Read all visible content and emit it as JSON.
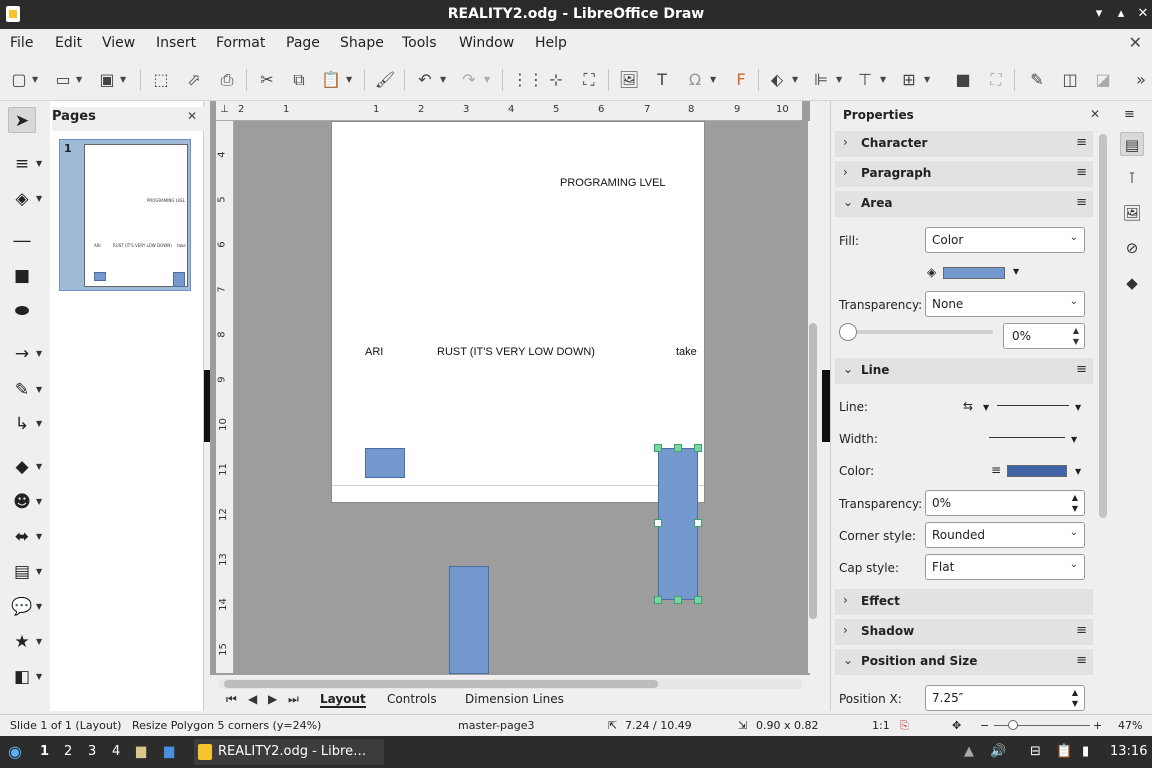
{
  "window": {
    "title": "REALITY2.odg - LibreOffice Draw"
  },
  "menu": [
    "File",
    "Edit",
    "View",
    "Insert",
    "Format",
    "Page",
    "Shape",
    "Tools",
    "Window",
    "Help"
  ],
  "pages_panel": {
    "title": "Pages",
    "thumb_number": "1"
  },
  "canvas": {
    "texts": {
      "programing": "PROGRAMING LVEL",
      "ari": "ARI",
      "rust": "RUST (IT'S VERY LOW DOWN)",
      "take": "take"
    },
    "shape_color": "#7499cf",
    "hruler": [
      "2",
      "1",
      "1",
      "2",
      "3",
      "4",
      "5",
      "6",
      "7",
      "8",
      "9",
      "10"
    ],
    "vruler": [
      "4",
      "5",
      "6",
      "7",
      "8",
      "9",
      "10",
      "11",
      "12",
      "13",
      "14",
      "15"
    ]
  },
  "tabs": [
    "Layout",
    "Controls",
    "Dimension Lines"
  ],
  "sidebar": {
    "title": "Properties",
    "sections": {
      "character": "Character",
      "paragraph": "Paragraph",
      "area": "Area",
      "line": "Line",
      "effect": "Effect",
      "shadow": "Shadow",
      "position": "Position and Size"
    },
    "area": {
      "fill_label": "Fill:",
      "fill_value": "Color",
      "fill_color": "#7499cf",
      "transparency_label": "Transparency:",
      "transparency_value": "None",
      "transparency_percent": "0%"
    },
    "line": {
      "line_label": "Line:",
      "width_label": "Width:",
      "color_label": "Color:",
      "line_color": "#3e64a6",
      "transparency_label": "Transparency:",
      "transparency_value": "0%",
      "corner_label": "Corner style:",
      "corner_value": "Rounded",
      "cap_label": "Cap style:",
      "cap_value": "Flat"
    },
    "position": {
      "x_label": "Position X:",
      "x_value": "7.25″"
    }
  },
  "status": {
    "slide": "Slide 1 of 1 (Layout)",
    "action": "Resize Polygon 5 corners (y=24%)",
    "master": "master-page3",
    "position": "7.24 / 10.49",
    "size": "0.90 x 0.82",
    "scale": "1:1",
    "zoom": "47%"
  },
  "taskbar": {
    "workspaces": [
      "1",
      "2",
      "3",
      "4"
    ],
    "app_label": "REALITY2.odg - Libre…",
    "clock": "13:16"
  }
}
